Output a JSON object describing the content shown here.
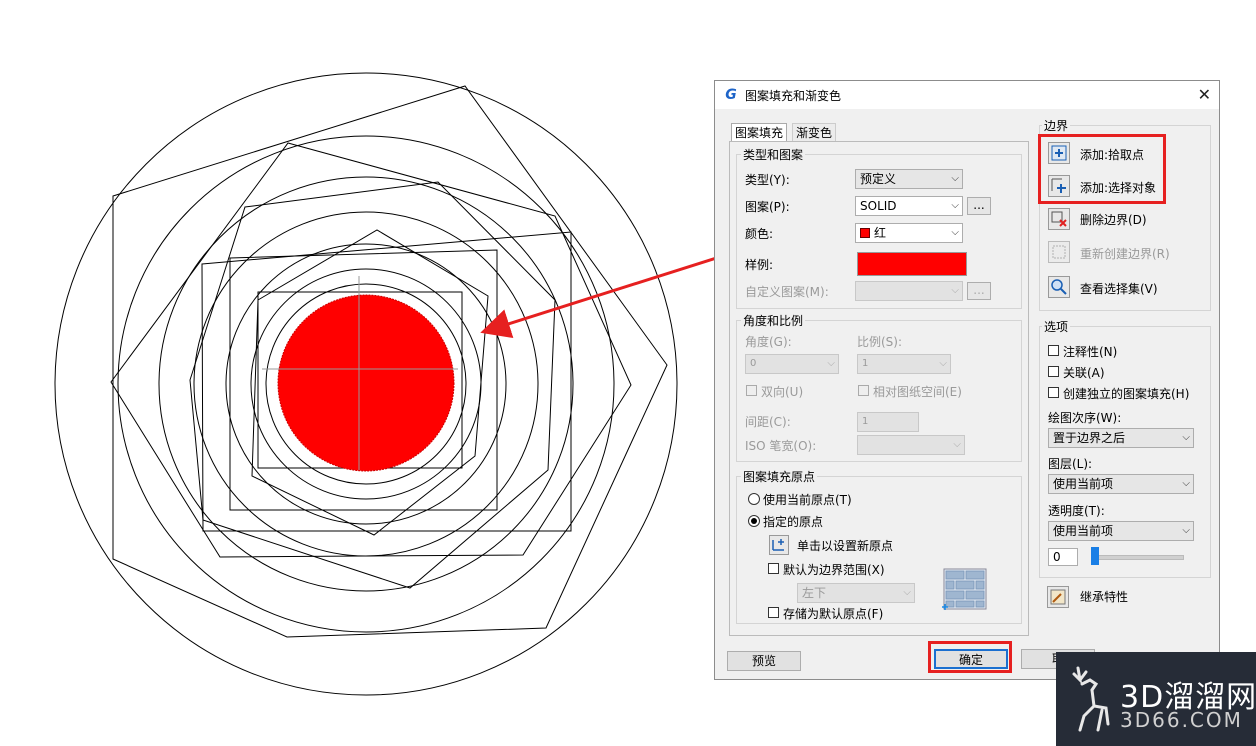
{
  "dialog": {
    "title": "图案填充和渐变色",
    "tabs": [
      "图案填充",
      "渐变色"
    ],
    "type_pattern": {
      "group_title": "类型和图案",
      "type_label": "类型(Y):",
      "type_value": "预定义",
      "pattern_label": "图案(P):",
      "pattern_value": "SOLID",
      "browse": "...",
      "color_label": "颜色:",
      "color_value": "红",
      "color_swatch": "#ff0000",
      "sample_label": "样例:",
      "custom_label": "自定义图案(M):"
    },
    "angle_scale": {
      "group_title": "角度和比例",
      "angle_label": "角度(G):",
      "angle_value": "0",
      "scale_label": "比例(S):",
      "scale_value": "1",
      "double_label": "双向(U)",
      "relative_label": "相对图纸空间(E)",
      "spacing_label": "间距(C):",
      "spacing_value": "1",
      "iso_label": "ISO 笔宽(O):"
    },
    "origin": {
      "group_title": "图案填充原点",
      "use_current": "使用当前原点(T)",
      "specified": "指定的原点",
      "click_set": "单击以设置新原点",
      "default_extent": "默认为边界范围(X)",
      "position_value": "左下",
      "store_default": "存储为默认原点(F)"
    },
    "boundary": {
      "group_title": "边界",
      "add_pick": "添加:拾取点",
      "add_select": "添加:选择对象",
      "remove": "删除边界(D)",
      "recreate": "重新创建边界(R)",
      "view": "查看选择集(V)"
    },
    "options": {
      "group_title": "选项",
      "annotative": "注释性(N)",
      "associative": "关联(A)",
      "separate": "创建独立的图案填充(H)",
      "draw_order_label": "绘图次序(W):",
      "draw_order_value": "置于边界之后",
      "layer_label": "图层(L):",
      "layer_value": "使用当前项",
      "transparency_label": "透明度(T):",
      "transparency_value": "使用当前项",
      "transparency_number": "0"
    },
    "inherit": "继承特性",
    "buttons": {
      "preview": "预览",
      "ok": "确定",
      "cancel": "取"
    }
  },
  "watermark": {
    "line1": "3D溜溜网",
    "line2": "3D66.COM"
  },
  "colors": {
    "accent_red": "#e62020",
    "fill_red": "#ff0000"
  }
}
